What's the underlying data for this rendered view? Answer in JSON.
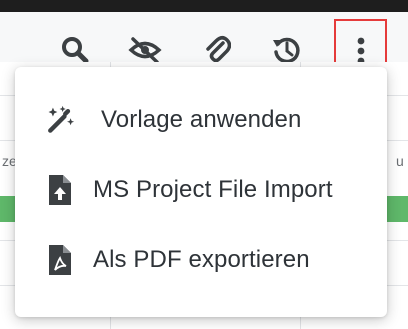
{
  "toolbar": {
    "icons": [
      "search-icon",
      "eye-off-icon",
      "paperclip-icon",
      "history-icon",
      "more-vertical-icon"
    ]
  },
  "menu": {
    "items": [
      {
        "label": "Vorlage anwenden",
        "icon": "magic-wand-icon"
      },
      {
        "label": "MS Project File Import",
        "icon": "file-upload-icon"
      },
      {
        "label": "Als PDF exportieren",
        "icon": "file-pdf-icon"
      }
    ]
  },
  "background": {
    "left_fragment": "ze",
    "right_fragment": "u"
  },
  "colors": {
    "icon": "#3c4043",
    "menu_text": "#2e3338",
    "highlight_border": "#e53b3b",
    "green_bar": "#5fb86a"
  }
}
